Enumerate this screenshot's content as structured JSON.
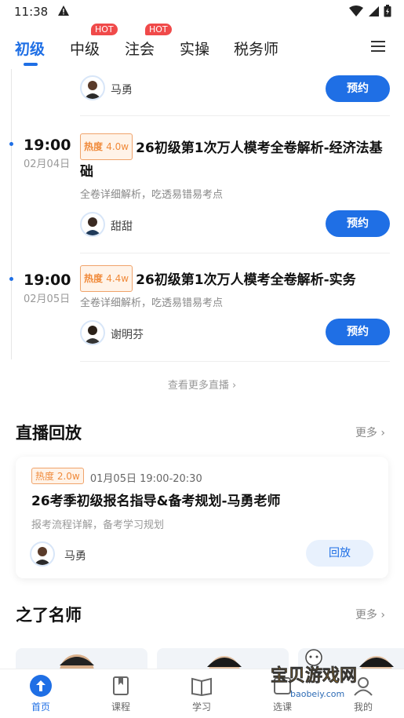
{
  "status_bar": {
    "time": "11:38"
  },
  "tabs": [
    {
      "label": "初级",
      "hot": ""
    },
    {
      "label": "中级",
      "hot": "HOT"
    },
    {
      "label": "注会",
      "hot": "HOT"
    },
    {
      "label": "实操",
      "hot": ""
    },
    {
      "label": "税务师",
      "hot": ""
    }
  ],
  "live_list": [
    {
      "teacher": "马勇",
      "button": "预约"
    },
    {
      "time": "19:00",
      "date": "02月04日",
      "heat_label": "热度",
      "heat_value": "4.0w",
      "title": "26初级第1次万人模考全卷解析-经济法基础",
      "desc": "全卷详细解析，吃透易错易考点",
      "teacher": "甜甜",
      "button": "预约"
    },
    {
      "time": "19:00",
      "date": "02月05日",
      "heat_label": "热度",
      "heat_value": "4.4w",
      "title": "26初级第1次万人模考全卷解析-实务",
      "desc": "全卷详细解析，吃透易错易考点",
      "teacher": "谢明芬",
      "button": "预约"
    }
  ],
  "see_more_live": "查看更多直播",
  "replay_section": {
    "title": "直播回放",
    "more": "更多",
    "card": {
      "heat_label": "热度",
      "heat_value": "2.0w",
      "time": "01月05日 19:00-20:30",
      "title": "26考季初级报名指导&备考规划-马勇老师",
      "desc": "报考流程详解，备考学习规划",
      "teacher": "马勇",
      "button": "回放"
    }
  },
  "teachers_section": {
    "title": "之了名师",
    "more": "更多"
  },
  "bottom_nav": [
    {
      "label": "首页",
      "icon": "home-arrow-icon",
      "active": true
    },
    {
      "label": "课程",
      "icon": "course-icon",
      "active": false
    },
    {
      "label": "学习",
      "icon": "book-icon",
      "active": false
    },
    {
      "label": "选课",
      "icon": "select-course-icon",
      "active": false
    },
    {
      "label": "我的",
      "icon": "profile-icon",
      "active": false
    }
  ],
  "watermark": {
    "text": "宝贝游戏网",
    "url": "baobeiy.com"
  },
  "colors": {
    "accent": "#1f6fe5",
    "hot": "#f04a4a",
    "heat": "#f08a3a"
  }
}
